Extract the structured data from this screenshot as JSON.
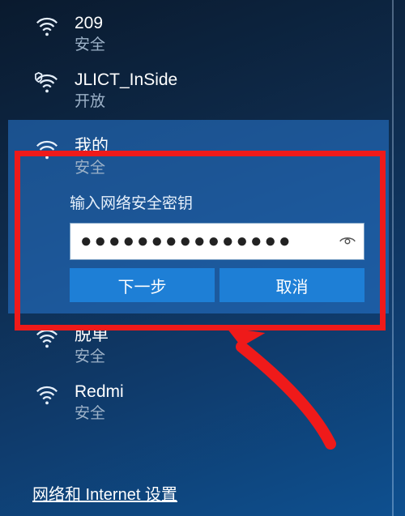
{
  "networks": [
    {
      "name": "209",
      "status": "安全",
      "shielded": false
    },
    {
      "name": "JLICT_InSide",
      "status": "开放",
      "shielded": true
    },
    {
      "name": "我的",
      "status": "安全",
      "shielded": false,
      "selected": true
    },
    {
      "name": "脱单",
      "status": "安全",
      "shielded": false
    },
    {
      "name": "Redmi",
      "status": "安全",
      "shielded": false
    }
  ],
  "connect_panel": {
    "prompt": "输入网络安全密钥",
    "password_mask": "●●●●●●●●●●●●●●●",
    "next_label": "下一步",
    "cancel_label": "取消"
  },
  "footer": {
    "settings_link": "网络和 Internet 设置"
  },
  "colors": {
    "accent": "#1e7fd6",
    "annotation": "#ef1a1a"
  }
}
